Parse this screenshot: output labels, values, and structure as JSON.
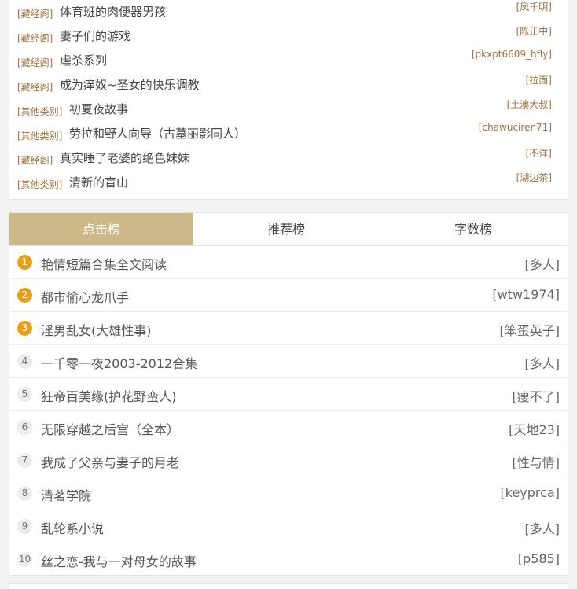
{
  "top_list": [
    {
      "category": "[藏经阁]",
      "title": "体育班的肉便器男孩",
      "author": "[凤千明]"
    },
    {
      "category": "[藏经阁]",
      "title": "妻子们的游戏",
      "author": "[陈正中]"
    },
    {
      "category": "[藏经阁]",
      "title": "虐杀系列",
      "author": "[pkxpt6609_hfly]"
    },
    {
      "category": "[藏经阁]",
      "title": "成为痒奴~圣女的快乐调教",
      "author": "[拉面]"
    },
    {
      "category": "[其他类别]",
      "title": "初夏夜故事",
      "author": "[土澳大叔]"
    },
    {
      "category": "[其他类别]",
      "title": "劳拉和野人向导（古墓丽影同人）",
      "author": "[chawuciren71]"
    },
    {
      "category": "[藏经阁]",
      "title": "真实睡了老婆的绝色妹妹",
      "author": "[不详]"
    },
    {
      "category": "[其他类别]",
      "title": "清新的盲山",
      "author": "[湖边茶]"
    }
  ],
  "tabs": {
    "click_rank": "点击榜",
    "recommend_rank": "推荐榜",
    "word_rank": "字数榜"
  },
  "ranking": [
    {
      "num": "1",
      "title": "艳情短篇合集全文阅读",
      "author": "[多人]"
    },
    {
      "num": "2",
      "title": "都市偷心龙爪手",
      "author": "[wtw1974]"
    },
    {
      "num": "3",
      "title": "淫男乱女(大雄性事)",
      "author": "[笨蛋英子]"
    },
    {
      "num": "4",
      "title": "一千零一夜2003-2012合集",
      "author": "[多人]"
    },
    {
      "num": "5",
      "title": "狂帝百美缘(护花野蛮人)",
      "author": "[瘦不了]"
    },
    {
      "num": "6",
      "title": "无限穿越之后宫（全本）",
      "author": "[天地23]"
    },
    {
      "num": "7",
      "title": "我成了父亲与妻子的月老",
      "author": "[性与情]"
    },
    {
      "num": "8",
      "title": "清茗学院",
      "author": "[keyprca]"
    },
    {
      "num": "9",
      "title": "乱轮系小说",
      "author": "[多人]"
    },
    {
      "num": "10",
      "title": "丝之恋-我与一对母女的故事",
      "author": "[p585]"
    }
  ],
  "colors": {
    "accent": "#cdb988",
    "category": "#a0703a",
    "hot_rank": "#e7a01b"
  }
}
